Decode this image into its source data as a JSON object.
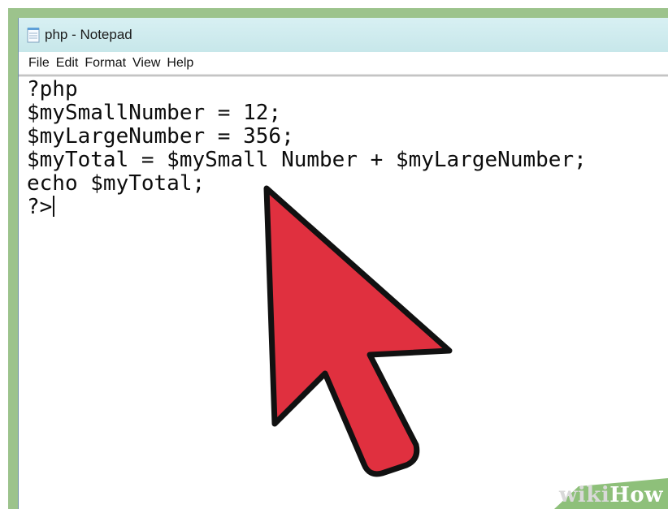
{
  "window": {
    "title": "php - Notepad"
  },
  "menu": [
    {
      "label": "File"
    },
    {
      "label": "Edit"
    },
    {
      "label": "Format"
    },
    {
      "label": "View"
    },
    {
      "label": "Help"
    }
  ],
  "editor": {
    "lines": [
      "?php",
      "$mySmallNumber = 12;",
      "$myLargeNumber = 356;",
      "$myTotal = $mySmall Number + $myLargeNumber;",
      "echo $myTotal;",
      "?>"
    ]
  },
  "overlay": {
    "arrow_color": "#e0303f",
    "arrow_outline": "#111111"
  },
  "watermark": {
    "wiki": "wiki",
    "how": "How"
  },
  "colors": {
    "border_green": "#9cc38c",
    "titlebar": "#d1ecef"
  }
}
